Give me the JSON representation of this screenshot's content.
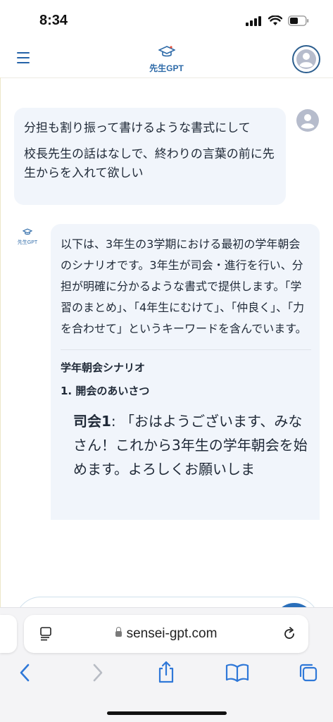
{
  "status_bar": {
    "time": "8:34"
  },
  "header": {
    "brand": "先生GPT"
  },
  "chat": {
    "user_lines": [
      "分担も割り振って書けるような書式にして",
      "校長先生の話はなしで、終わりの言葉の前に先生からを入れて欲しい"
    ],
    "bot_logo_label": "先生GPT",
    "bot_intro": "以下は、3年生の3学期における最初の学年朝会のシナリオです。3年生が司会・進行を行い、分担が明確に分かるような書式で提供します。「学習のまとめ」、「4年生にむけて」、「仲良く」、「力を合わせて」というキーワードを含んでいます。",
    "scenario_title": "学年朝会シナリオ",
    "section_1": "1. 開会のあいさつ",
    "speaker_1": "司会1",
    "speech_1": ": 「おはようございます、みなさん！これから3年生の学年朝会を始めます。よろしくお願いしま"
  },
  "input": {
    "placeholder": ""
  },
  "browser": {
    "url": "sensei-gpt.com"
  },
  "colors": {
    "accent": "#2a6fba",
    "bubble": "#f1f5fb",
    "brand": "#2d6aa8"
  },
  "icons": [
    "menu-icon",
    "graduation-cap-icon",
    "user-avatar-icon",
    "voice-waveform-icon",
    "reader-icon",
    "lock-icon",
    "reload-icon",
    "back-icon",
    "forward-icon",
    "share-icon",
    "bookmarks-icon",
    "tabs-icon"
  ]
}
